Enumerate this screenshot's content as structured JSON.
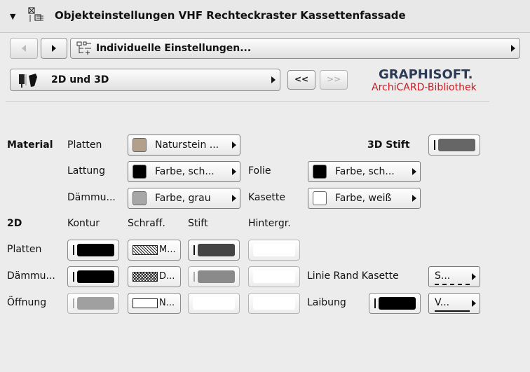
{
  "header": {
    "title": "Objekteinstellungen VHF Rechteckraster Kassettenfassade"
  },
  "nav": {
    "page_label": "Individuelle Einstellungen..."
  },
  "view": {
    "mode_label": "2D und 3D",
    "prev_label": "<<",
    "next_label": ">>"
  },
  "brand": {
    "name": "GRAPHISOFT.",
    "sub": "ArchiCARD-Bibliothek",
    "sub_color": "#d0161c",
    "name_color": "#2b3a55"
  },
  "material": {
    "section_label": "Material",
    "pen3d_label": "3D Stift",
    "rows": [
      {
        "label": "Platten",
        "value": "Naturstein ...",
        "color": "#b3a08a"
      },
      {
        "label": "Lattung",
        "value": "Farbe, sch...",
        "color": "#000000"
      },
      {
        "label": "Dämmu...",
        "value": "Farbe, grau",
        "color": "#a7a7a7"
      },
      {
        "label": "Folie",
        "value": "Farbe, sch...",
        "color": "#000000"
      },
      {
        "label": "Kasette",
        "value": "Farbe, weiß",
        "color": "#ffffff"
      }
    ]
  },
  "twod": {
    "section_label": "2D",
    "columns": [
      "Kontur",
      "Schraff.",
      "Stift",
      "Hintergr."
    ],
    "rows": [
      {
        "label": "Platten",
        "fill_text": "M..."
      },
      {
        "label": "Dämmu...",
        "fill_text": "D..."
      },
      {
        "label": "Öffnung",
        "fill_text": "N..."
      }
    ],
    "linie_label": "Linie Rand Kasette",
    "linie_value": "S...",
    "laibung_label": "Laibung",
    "laibung_value": "V..."
  }
}
